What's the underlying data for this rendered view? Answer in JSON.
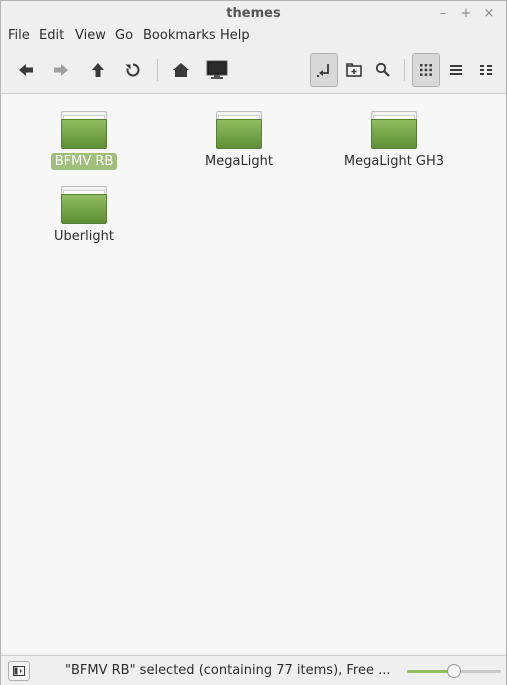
{
  "window": {
    "title": "themes"
  },
  "window_controls": {
    "minimize": "–",
    "maximize": "+",
    "close": "×"
  },
  "menubar": {
    "items": [
      "File",
      "Edit",
      "View",
      "Go",
      "Bookmarks",
      "Help"
    ]
  },
  "toolbar": {
    "buttons": [
      "back-icon",
      "forward-icon",
      "up-icon",
      "reload-icon",
      "home-icon",
      "computer-icon",
      "toggle-location-icon",
      "new-folder-icon",
      "search-icon",
      "icon-view-icon",
      "list-view-icon",
      "compact-view-icon"
    ],
    "active": [
      "toggle-location-icon",
      "icon-view-icon"
    ]
  },
  "folders": [
    {
      "name": "BFMV RB",
      "selected": true
    },
    {
      "name": "MegaLight",
      "selected": false
    },
    {
      "name": "MegaLight GH3",
      "selected": false
    },
    {
      "name": "Uberlight",
      "selected": false
    }
  ],
  "statusbar": {
    "text": "\"BFMV RB\" selected (containing 77 items), Free ...",
    "zoom_level": 0.5
  },
  "colors": {
    "folder": "#7aa84c",
    "selection": "#9fbf7a",
    "accent": "#8fbd5f"
  }
}
